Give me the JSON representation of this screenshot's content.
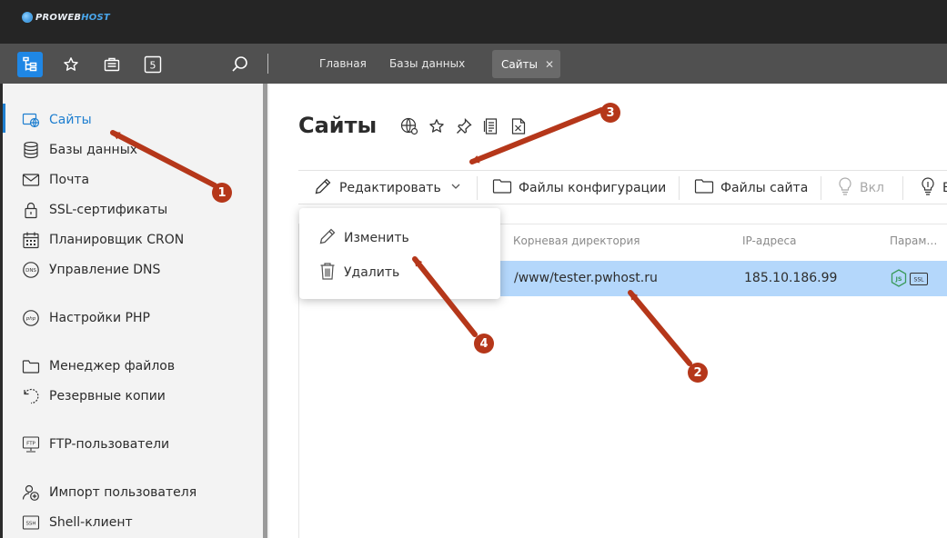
{
  "brand": {
    "logo_text_a": "PROWEB",
    "logo_text_b": "HOST"
  },
  "topbar": {
    "crumbs": [
      "Главная",
      "Базы данных"
    ],
    "active_tab": "Сайты",
    "tab_close": "✕",
    "pinned_count": "5"
  },
  "sidebar": {
    "items": [
      {
        "label": "Сайты",
        "icon": "globe-icon",
        "active": true
      },
      {
        "label": "Базы данных",
        "icon": "database-icon"
      },
      {
        "label": "Почта",
        "icon": "mail-icon"
      },
      {
        "label": "SSL-сертификаты",
        "icon": "lock-icon"
      },
      {
        "label": "Планировщик CRON",
        "icon": "calendar-icon"
      },
      {
        "label": "Управление DNS",
        "icon": "dns-icon"
      },
      {
        "label": "Настройки PHP",
        "icon": "php-icon"
      },
      {
        "label": "Менеджер файлов",
        "icon": "folder-icon"
      },
      {
        "label": "Резервные копии",
        "icon": "backup-icon"
      },
      {
        "label": "FTP-пользователи",
        "icon": "ftp-icon"
      },
      {
        "label": "Импорт пользователя",
        "icon": "user-import-icon"
      },
      {
        "label": "Shell-клиент",
        "icon": "ssh-icon"
      }
    ]
  },
  "main": {
    "title": "Сайты",
    "actions": {
      "edit": "Редактировать",
      "config_files": "Файлы конфигурации",
      "site_files": "Файлы сайта",
      "enable": "Вкл",
      "disable": "В"
    },
    "dropdown": {
      "change": "Изменить",
      "delete": "Удалить"
    },
    "table": {
      "headers": {
        "root": "Корневая директория",
        "ip": "IP-адреса",
        "params": "Парам…"
      },
      "row": {
        "root": "/www/tester.pwhost.ru",
        "ip": "185.10.186.99",
        "badge_js": "JS",
        "badge_ssl": "SSL"
      }
    }
  },
  "annotations": {
    "b1": "1",
    "b2": "2",
    "b3": "3",
    "b4": "4",
    "arrow_color": "#b5371a"
  }
}
